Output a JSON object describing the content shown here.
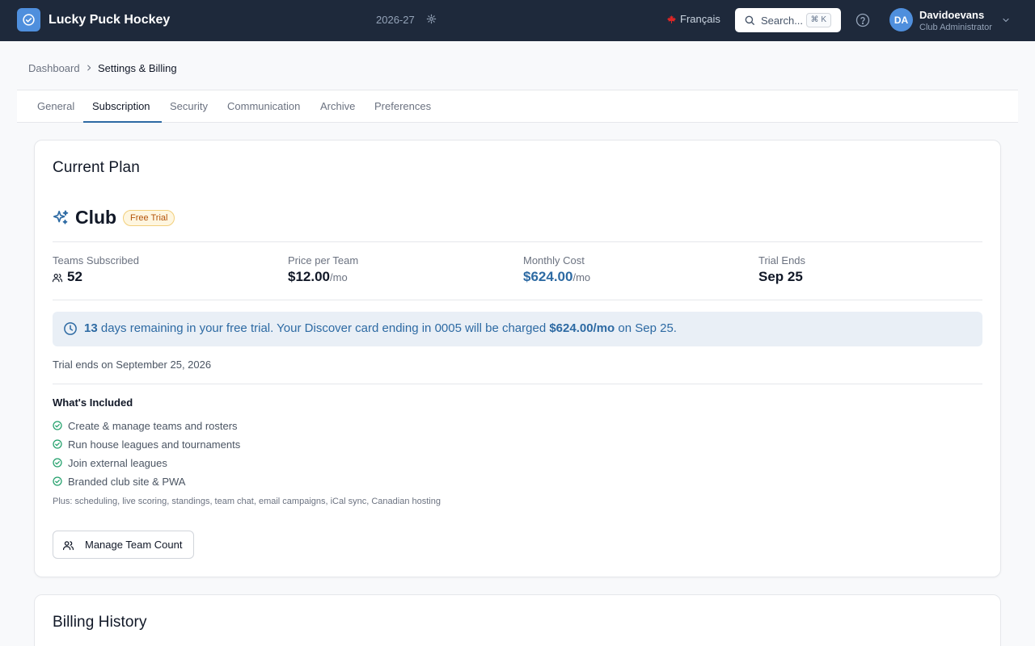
{
  "header": {
    "app_name": "Lucky Puck Hockey",
    "season": "2026-27",
    "language": "Français",
    "search_placeholder": "Search...",
    "search_shortcut": "⌘ K",
    "user_initials": "DA",
    "user_name": "Davidoevans",
    "user_role": "Club Administrator"
  },
  "breadcrumb": {
    "parent": "Dashboard",
    "current": "Settings & Billing"
  },
  "tabs": [
    {
      "label": "General"
    },
    {
      "label": "Subscription",
      "active": true
    },
    {
      "label": "Security"
    },
    {
      "label": "Communication"
    },
    {
      "label": "Archive"
    },
    {
      "label": "Preferences"
    }
  ],
  "current_plan": {
    "section_title": "Current Plan",
    "plan_name": "Club",
    "badge": "Free Trial",
    "stats": {
      "teams_label": "Teams Subscribed",
      "teams_value": "52",
      "price_label": "Price per Team",
      "price_value": "$12.00",
      "price_unit": "/mo",
      "monthly_label": "Monthly Cost",
      "monthly_value": "$624.00",
      "monthly_unit": "/mo",
      "trial_label": "Trial Ends",
      "trial_value": "Sep 25"
    },
    "notice": {
      "days": "13",
      "text_1": " days remaining in your free trial. Your Discover card ending in 0005 will be charged ",
      "amount": "$624.00/mo",
      "text_2": " on Sep 25."
    },
    "trial_ends_text": "Trial ends on September 25, 2026",
    "included_title": "What's Included",
    "features": [
      "Create & manage teams and rosters",
      "Run house leagues and tournaments",
      "Join external leagues",
      "Branded club site & PWA"
    ],
    "plus_text": "Plus: scheduling, live scoring, standings, team chat, email campaigns, iCal sync, Canadian hosting",
    "manage_button": "Manage Team Count"
  },
  "billing_history": {
    "section_title": "Billing History"
  },
  "colors": {
    "topbar": "#1e293b",
    "accent": "#2d6aa3",
    "success": "#22a06b",
    "badge_text": "#b45309"
  },
  "icons": [
    "logo-icon",
    "gear-icon",
    "maple-leaf-icon",
    "search-icon",
    "help-icon",
    "chevron-down-icon",
    "chevron-right-icon",
    "sparkles-icon",
    "users-icon",
    "clock-icon",
    "check-circle-icon"
  ]
}
